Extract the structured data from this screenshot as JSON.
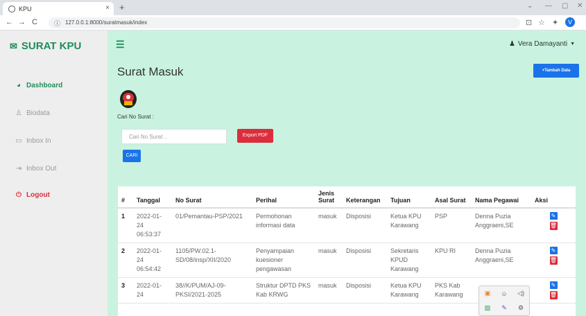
{
  "browser": {
    "tab_title": "KPU",
    "url": "127.0.0.1:8000/suratmasuk/index"
  },
  "sidebar": {
    "brand": "SURAT KPU",
    "items": [
      {
        "label": "Dashboard",
        "icon": "dashboard-icon"
      },
      {
        "label": "Biodata",
        "icon": "user-icon"
      },
      {
        "label": "Inbox In",
        "icon": "inbox-icon"
      },
      {
        "label": "Inbox Out",
        "icon": "sign-out-icon"
      },
      {
        "label": "Logout",
        "icon": "power-icon"
      }
    ]
  },
  "topbar": {
    "user": "Vera Damayanti"
  },
  "main": {
    "title": "Surat Masuk",
    "add_button": "+Tambah Data",
    "search_label": "Cari No Surat :",
    "search_placeholder": "Cari No Surat ..",
    "export_button": "Export PDF",
    "search_button": "CARI"
  },
  "table": {
    "headers": [
      "#",
      "Tanggal",
      "No Surat",
      "Perihal",
      "Jenis Surat",
      "Keterangan",
      "Tujuan",
      "Asal Surat",
      "Nama Pegawai",
      "Aksi"
    ],
    "rows": [
      [
        "1",
        "2022-01-24 06:53:37",
        "01/Pemantau-PSP/2021",
        "Permohonan informasi data",
        "masuk",
        "Disposisi",
        "Ketua KPU Karawang",
        "PSP",
        "Denna Puzia Anggraeni,SE"
      ],
      [
        "2",
        "2022-01-24 06:54:42",
        "1105/PW.02.1-SD/08/insp/XII/2020",
        "Penyampaian kuesioner pengawasan",
        "masuk",
        "Disposisi",
        "Sekretaris KPUD Karawang",
        "KPU RI",
        "Denna Puzia Anggraeni,SE"
      ],
      [
        "3",
        "2022-01-24",
        "38//K/PUM/AJ-09-PKSI/2021-2025",
        "Struktur DPTD PKS Kab KRWG",
        "masuk",
        "Disposisi",
        "Ketua KPU Karawang",
        "PKS Kab Karawang",
        ""
      ]
    ]
  },
  "colors": {
    "accent": "#1e8e5a",
    "primary": "#1a73e8",
    "danger": "#dc2d3c",
    "content_bg": "#c9f3e0",
    "sidebar_bg": "#eeeeee",
    "logout": "#dc2d3c"
  }
}
